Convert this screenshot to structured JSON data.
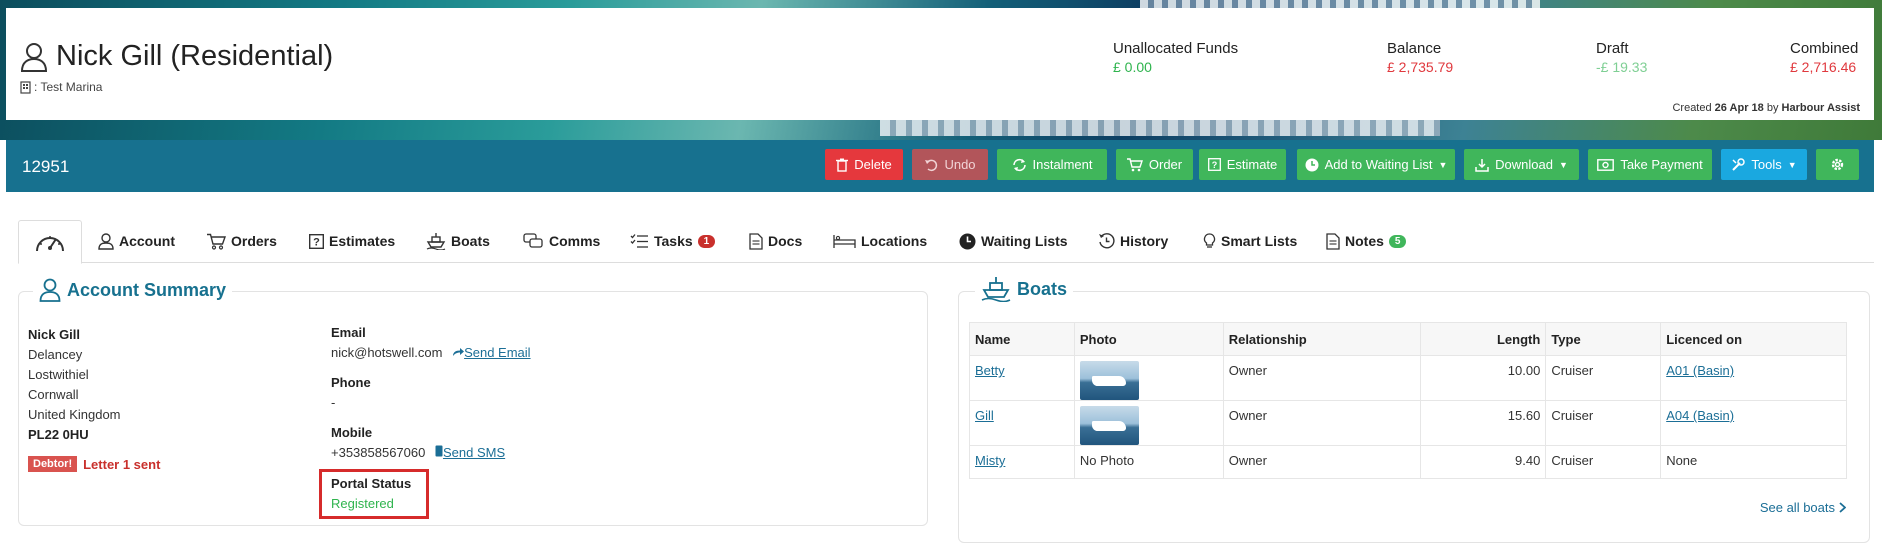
{
  "header": {
    "customer_name": "Nick Gill (Residential)",
    "marina": ": Test Marina",
    "funds": [
      {
        "label": "Unallocated Funds",
        "value": "£ 0.00",
        "color": "#2fb44e"
      },
      {
        "label": "Balance",
        "value": "£ 2,735.79",
        "color": "#e0393e"
      },
      {
        "label": "Draft",
        "value": "-£ 19.33",
        "color": "#7fcf94",
        "label_color": "#999999"
      },
      {
        "label": "Combined",
        "value": "£ 2,716.46",
        "color": "#e0393e"
      }
    ],
    "created_prefix": "Created",
    "created_date": "26 Apr 18",
    "created_by_prefix": "by",
    "created_by": "Harbour Assist"
  },
  "toolbar": {
    "account_id": "12951",
    "buttons": {
      "delete": "Delete",
      "undo": "Undo",
      "instalment": "Instalment",
      "order": "Order",
      "estimate": "Estimate",
      "waiting_list": "Add to Waiting List",
      "download": "Download",
      "take_payment": "Take Payment",
      "tools": "Tools"
    }
  },
  "tabs": {
    "account": "Account",
    "orders": "Orders",
    "estimates": "Estimates",
    "boats": "Boats",
    "comms": "Comms",
    "tasks": "Tasks",
    "tasks_badge": "1",
    "docs": "Docs",
    "locations": "Locations",
    "waiting_lists": "Waiting Lists",
    "history": "History",
    "smart_lists": "Smart Lists",
    "notes": "Notes",
    "notes_badge": "5"
  },
  "account_summary": {
    "title": "Account Summary",
    "name": "Nick Gill",
    "address_lines": [
      "Delancey",
      "Lostwithiel",
      "Cornwall",
      "United Kingdom"
    ],
    "postcode": "PL22 0HU",
    "debtor_tag": "Debtor!",
    "debtor_text": "Letter 1 sent",
    "email_label": "Email",
    "email": "nick@hotswell.com",
    "send_email": "Send Email",
    "phone_label": "Phone",
    "phone": "-",
    "mobile_label": "Mobile",
    "mobile": "+353858567060",
    "send_sms": "Send SMS",
    "portal_label": "Portal Status",
    "portal_status": "Registered"
  },
  "boats": {
    "title": "Boats",
    "columns": [
      "Name",
      "Photo",
      "Relationship",
      "Length",
      "Type",
      "Licenced on"
    ],
    "rows": [
      {
        "name": "Betty",
        "photo": "",
        "relationship": "Owner",
        "length": "10.00",
        "type": "Cruiser",
        "licenced": "A01 (Basin)"
      },
      {
        "name": "Gill",
        "photo": "",
        "relationship": "Owner",
        "length": "15.60",
        "type": "Cruiser",
        "licenced": "A04 (Basin)"
      },
      {
        "name": "Misty",
        "photo": "No Photo",
        "relationship": "Owner",
        "length": "9.40",
        "type": "Cruiser",
        "licenced": "None"
      }
    ],
    "see_all": "See all boats"
  }
}
